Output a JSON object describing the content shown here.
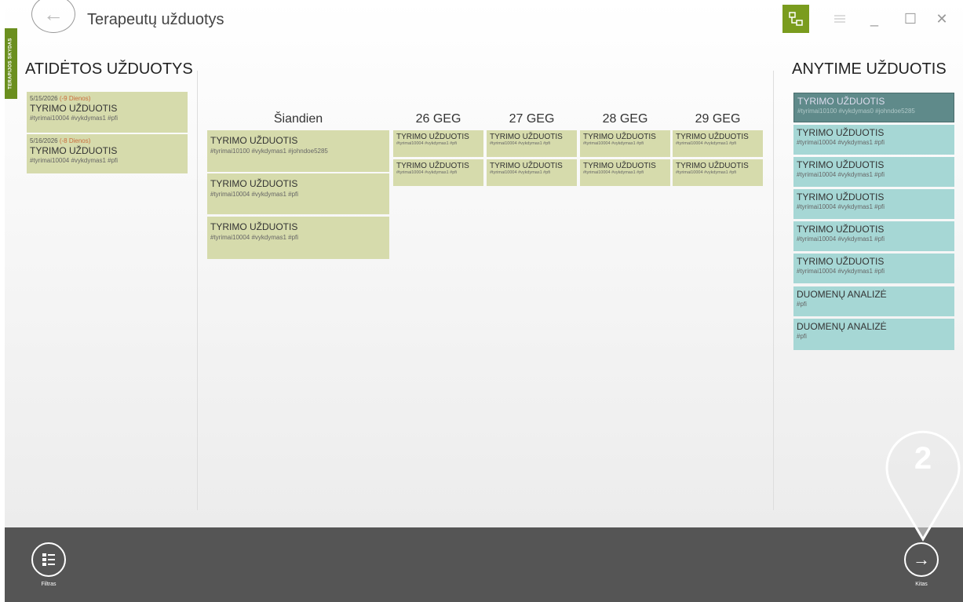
{
  "window": {
    "title": "Terapeutų užduotys",
    "side_tab": "TERAPIJOS SKYDAS",
    "controls": {
      "minimize": "_",
      "maximize": "☐",
      "close": "✕"
    }
  },
  "overdue": {
    "heading": "ATIDĖTOS UŽDUOTYS",
    "items": [
      {
        "date": "5/15/2026",
        "late": "(-9 Dienos)",
        "title": "TYRIMO UŽDUOTIS",
        "tags": "#tyrimai10004 #vykdymas1 #pfi"
      },
      {
        "date": "5/16/2026",
        "late": "(-8 Dienos)",
        "title": "TYRIMO UŽDUOTIS",
        "tags": "#tyrimai10004 #vykdymas1 #pfi"
      }
    ]
  },
  "schedule": {
    "today": {
      "label": "Šiandien",
      "tasks": [
        {
          "title": "TYRIMO UŽDUOTIS",
          "tags": "#tyrimai10100 #vykdymas1 #johndoe5285"
        },
        {
          "title": "TYRIMO UŽDUOTIS",
          "tags": "#tyrimai10004 #vykdymas1 #pfi"
        },
        {
          "title": "TYRIMO UŽDUOTIS",
          "tags": "#tyrimai10004 #vykdymas1 #pfi"
        }
      ]
    },
    "days": [
      {
        "label": "26 GEG",
        "tasks": [
          {
            "title": "TYRIMO UŽDUOTIS",
            "tags": "#tyrimai10004 #vykdymas1 #pfi"
          },
          {
            "title": "TYRIMO UŽDUOTIS",
            "tags": "#tyrimai10004 #vykdymas1 #pfi"
          }
        ]
      },
      {
        "label": "27 GEG",
        "tasks": [
          {
            "title": "TYRIMO UŽDUOTIS",
            "tags": "#tyrimai10004 #vykdymas1 #pfi"
          },
          {
            "title": "TYRIMO UŽDUOTIS",
            "tags": "#tyrimai10004 #vykdymas1 #pfi"
          }
        ]
      },
      {
        "label": "28 GEG",
        "tasks": [
          {
            "title": "TYRIMO UŽDUOTIS",
            "tags": "#tyrimai10004 #vykdymas1 #pfi"
          },
          {
            "title": "TYRIMO UŽDUOTIS",
            "tags": "#tyrimai10004 #vykdymas1 #pfi"
          }
        ]
      },
      {
        "label": "29 GEG",
        "tasks": [
          {
            "title": "TYRIMO UŽDUOTIS",
            "tags": "#tyrimai10004 #vykdymas1 #pfi"
          },
          {
            "title": "TYRIMO UŽDUOTIS",
            "tags": "#tyrimai10004 #vykdymas1 #pfi"
          }
        ]
      }
    ]
  },
  "anytime": {
    "heading": "ANYTIME UŽDUOTIS",
    "items": [
      {
        "title": "TYRIMO UŽDUOTIS",
        "tags": "#tyrimai10100 #vykdymas0 #johndoe5285"
      },
      {
        "title": "TYRIMO UŽDUOTIS",
        "tags": "#tyrimai10004 #vykdymas1 #pfi"
      },
      {
        "title": "TYRIMO UŽDUOTIS",
        "tags": "#tyrimai10004 #vykdymas1 #pfi"
      },
      {
        "title": "TYRIMO UŽDUOTIS",
        "tags": "#tyrimai10004 #vykdymas1 #pfi"
      },
      {
        "title": "TYRIMO UŽDUOTIS",
        "tags": "#tyrimai10004 #vykdymas1 #pfi"
      },
      {
        "title": "TYRIMO UŽDUOTIS",
        "tags": "#tyrimai10004 #vykdymas1 #pfi"
      },
      {
        "title": "DUOMENŲ ANALIZĖ",
        "tags": "#pfi"
      },
      {
        "title": "DUOMENŲ ANALIZĖ",
        "tags": "#pfi"
      }
    ]
  },
  "bottom": {
    "filter_label": "Filtras",
    "next_label": "Kitas"
  },
  "tutorial": {
    "step": "2"
  },
  "colors": {
    "accent": "#7a9c1e",
    "task": "#d6dbac",
    "anytime": "#a6d7d5",
    "bar": "#555555"
  }
}
